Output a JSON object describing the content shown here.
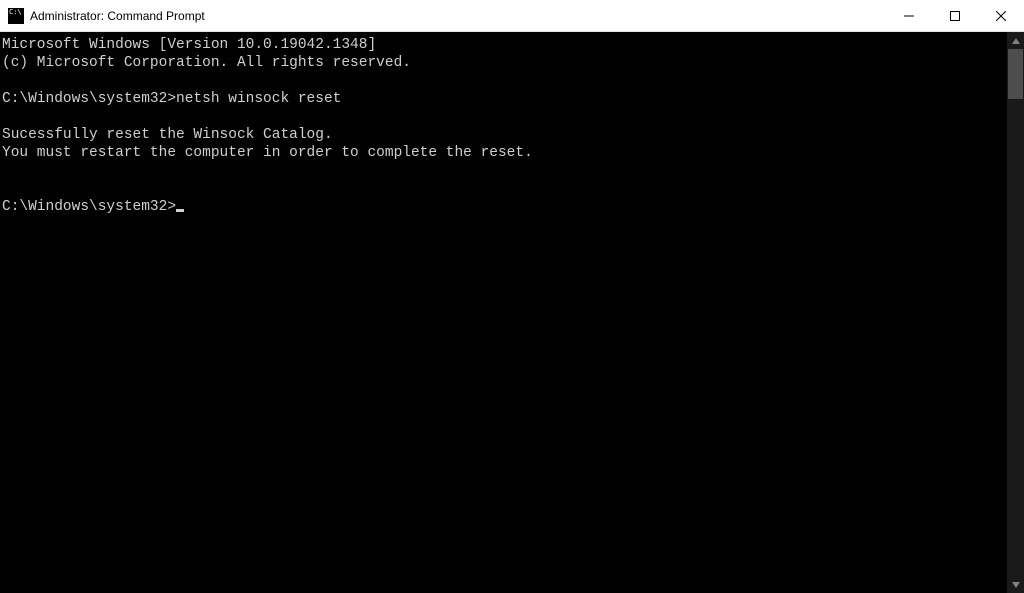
{
  "window": {
    "title": "Administrator: Command Prompt"
  },
  "terminal": {
    "lines": [
      "Microsoft Windows [Version 10.0.19042.1348]",
      "(c) Microsoft Corporation. All rights reserved.",
      "",
      "C:\\Windows\\system32>netsh winsock reset",
      "",
      "Sucessfully reset the Winsock Catalog.",
      "You must restart the computer in order to complete the reset.",
      "",
      "",
      "C:\\Windows\\system32>"
    ]
  }
}
